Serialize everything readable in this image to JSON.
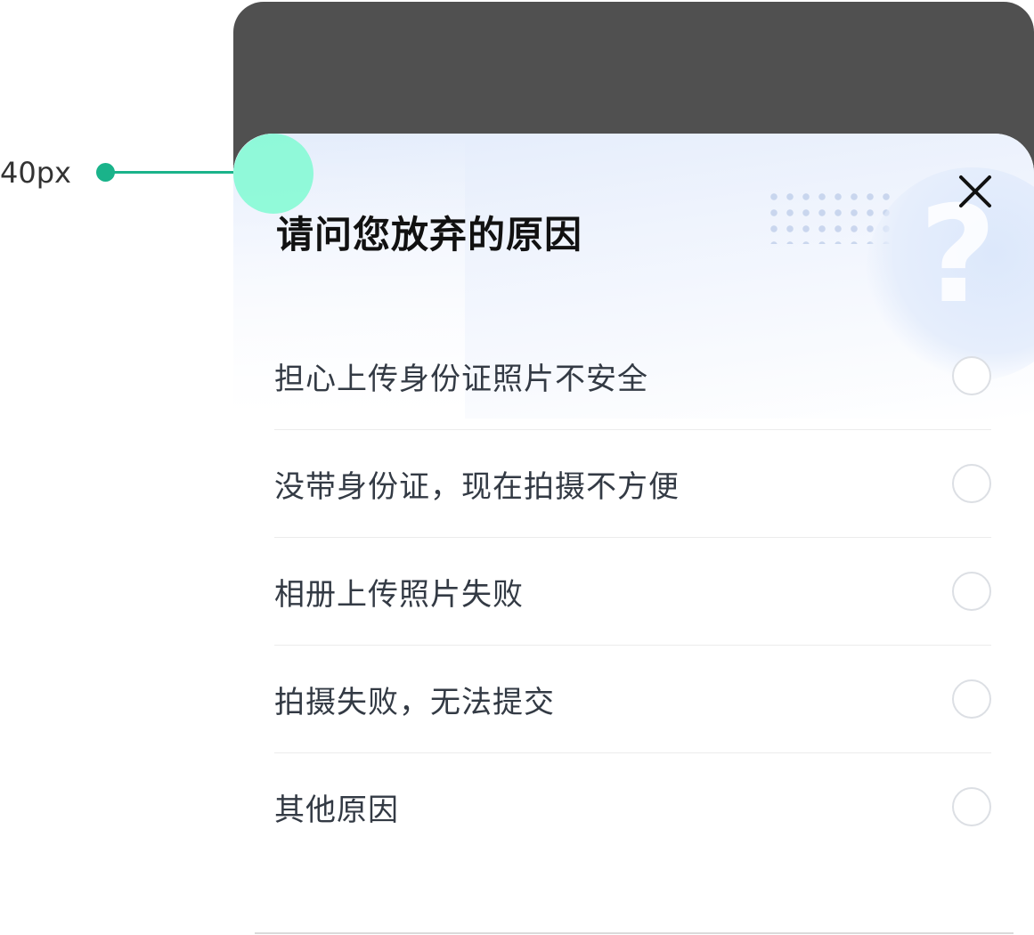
{
  "annotation": {
    "label": "40px",
    "color": "#1ab38a",
    "highlight_color": "#80fad2"
  },
  "dialog": {
    "title": "请问您放弃的原因",
    "close_icon": "close-icon",
    "decoration_icon": "question-mark-icon",
    "decoration_glyph": "?",
    "options": [
      {
        "label": "担心上传身份证照片不安全",
        "selected": false
      },
      {
        "label": "没带身份证，现在拍摄不方便",
        "selected": false
      },
      {
        "label": "相册上传照片失败",
        "selected": false
      },
      {
        "label": "拍摄失败，无法提交",
        "selected": false
      },
      {
        "label": "其他原因",
        "selected": false
      }
    ]
  },
  "colors": {
    "overlay": "#505050",
    "title": "#111111",
    "option_text": "#333a44",
    "radio_border": "#dcdfe4",
    "gradient_top": "#e3ecfb"
  }
}
